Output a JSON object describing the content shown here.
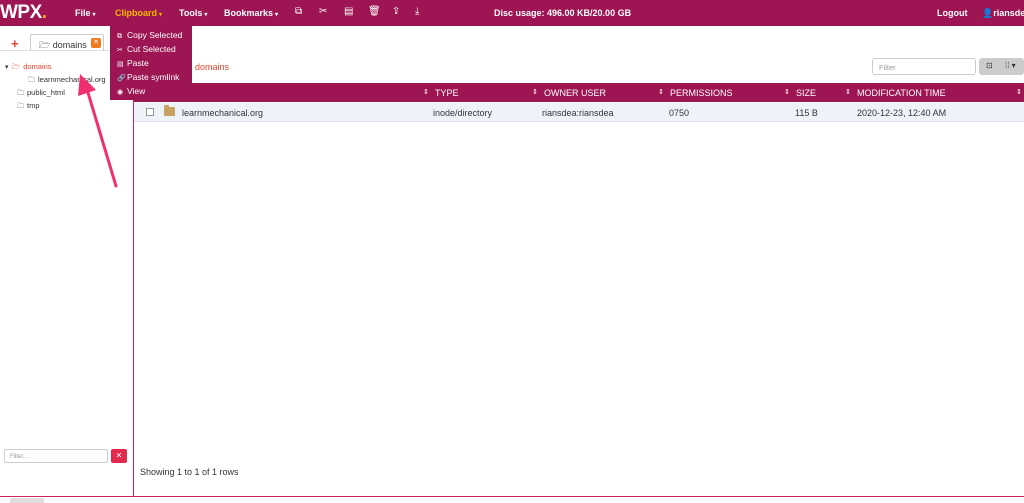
{
  "topbar": {
    "logo": "WPX",
    "logo_dot": ".",
    "menus": [
      {
        "label": "File",
        "caret": "▾"
      },
      {
        "label": "Clipboard",
        "caret": "▾"
      },
      {
        "label": "Tools",
        "caret": "▾"
      },
      {
        "label": "Bookmarks",
        "caret": "▾"
      }
    ],
    "toolbar_icons": [
      "copy-icon",
      "cut-icon",
      "paste-icon",
      "trash-icon",
      "upload-icon",
      "download-icon"
    ],
    "disc_usage": "Disc usage: 496.00 KB/20.00 GB",
    "logout": "Logout",
    "user": "riansdea"
  },
  "clipboard_menu": {
    "items": [
      {
        "label": "Copy Selected",
        "icon": "copy-icon"
      },
      {
        "label": "Cut Selected",
        "icon": "cut-icon"
      },
      {
        "label": "Paste",
        "icon": "paste-icon"
      },
      {
        "label": "Paste symlink",
        "icon": "link-icon"
      },
      {
        "label": "View",
        "icon": "eye-icon"
      }
    ]
  },
  "sidebar": {
    "tab_label": "domains",
    "tree": [
      {
        "label": "domains",
        "level": 0,
        "expanded": true
      },
      {
        "label": "learnmechanical.org",
        "level": 1
      },
      {
        "label": "public_html",
        "level": 0
      },
      {
        "label": "tmp",
        "level": 0
      }
    ],
    "filter_placeholder": "Filter..."
  },
  "main": {
    "breadcrumb": "domains",
    "filter_placeholder": "Filter",
    "columns": [
      "TYPE",
      "OWNER USER",
      "PERMISSIONS",
      "SIZE",
      "MODIFICATION TIME"
    ],
    "rows": [
      {
        "name": "learnmechanical.org",
        "type": "inode/directory",
        "owner": "riansdea:riansdea",
        "permissions": "0750",
        "size": "115 B",
        "mtime": "2020-12-23, 12:40 AM"
      }
    ],
    "showing": "Showing 1 to 1 of 1 rows"
  },
  "colors": {
    "accent": "#9d1552",
    "highlight": "#f5b800",
    "annotation": "#f0306e"
  }
}
